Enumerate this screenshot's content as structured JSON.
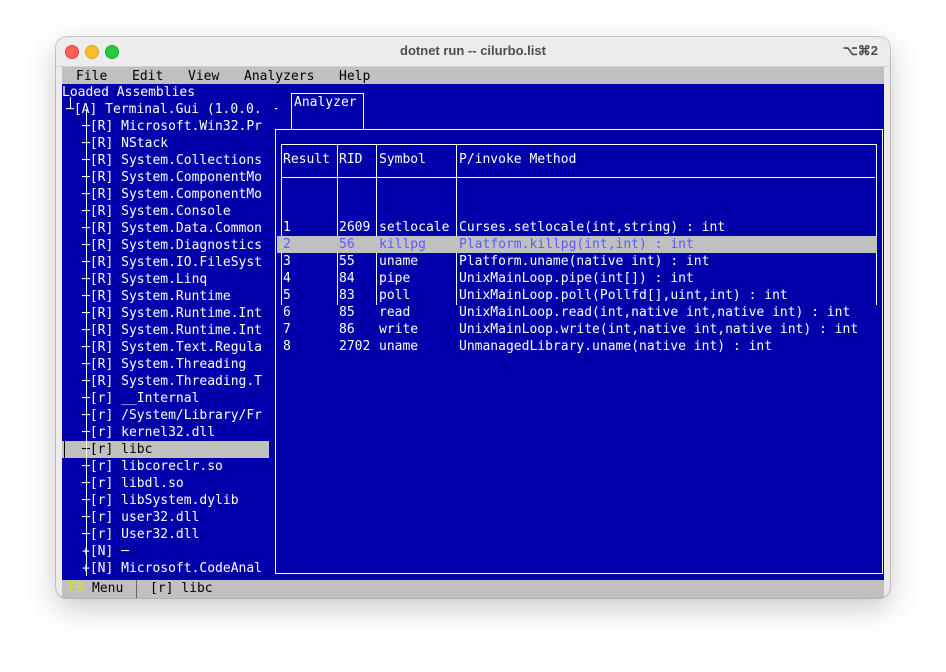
{
  "window": {
    "title": "dotnet run -- cilurbo.list",
    "shortcut": "⌥⌘2"
  },
  "menu": [
    "File",
    "Edit",
    "View",
    "Analyzers",
    "Help"
  ],
  "tree": {
    "header": "Loaded Assemblies",
    "root": "─[A] Terminal.Gui (1.0.0. ─",
    "items": [
      "─[R] Microsoft.Win32.Pr",
      "─[R] NStack",
      "─[R] System.Collections",
      "─[R] System.ComponentMo",
      "─[R] System.ComponentMo",
      "─[R] System.Console",
      "─[R] System.Data.Common",
      "─[R] System.Diagnostics",
      "─[R] System.IO.FileSyst",
      "─[R] System.Linq",
      "─[R] System.Runtime",
      "─[R] System.Runtime.Int",
      "─[R] System.Runtime.Int",
      "─[R] System.Text.Regula",
      "─[R] System.Threading",
      "─[R] System.Threading.T",
      "─[r] __Internal",
      "─[r] /System/Library/Fr",
      "─[r] kernel32.dll",
      "─[r] libc",
      "─[r] libcoreclr.so",
      "─[r] libdl.so",
      "─[r] libSystem.dylib",
      "─[r] user32.dll",
      "─[r] User32.dll",
      "+[N] ─",
      "+[N] Microsoft.CodeAnal"
    ],
    "selected_index": 19
  },
  "tab": {
    "label": "Analyzer"
  },
  "table": {
    "headers": [
      "Result",
      "RID",
      "Symbol",
      "P/invoke Method"
    ],
    "rows": [
      [
        "1",
        "2609",
        "setlocale",
        "Curses.setlocale(int,string) : int"
      ],
      [
        "2",
        "56",
        "killpg",
        "Platform.killpg(int,int) : int"
      ],
      [
        "3",
        "55",
        "uname",
        "Platform.uname(native int) : int"
      ],
      [
        "4",
        "84",
        "pipe",
        "UnixMainLoop.pipe(int[]) : int"
      ],
      [
        "5",
        "83",
        "poll",
        "UnixMainLoop.poll(Pollfd[],uint,int) : int"
      ],
      [
        "6",
        "85",
        "read",
        "UnixMainLoop.read(int,native int,native int) : int"
      ],
      [
        "7",
        "86",
        "write",
        "UnixMainLoop.write(int,native int,native int) : int"
      ],
      [
        "8",
        "2702",
        "uname",
        "UnmanagedLibrary.uname(native int) : int"
      ]
    ],
    "highlighted_row": 1
  },
  "status": {
    "fkey": "F9",
    "fkey_label": "Menu",
    "selection": "[r] libc"
  },
  "colors": {
    "terminal_bg": "#0000aa",
    "bar_bg": "#c0c0c0",
    "fkey": "#e6e600"
  }
}
